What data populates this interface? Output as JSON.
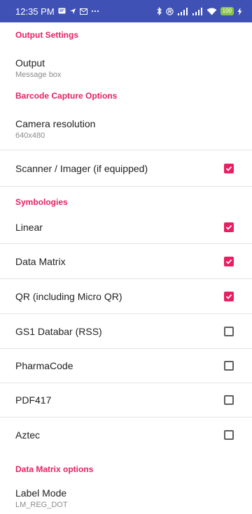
{
  "status_bar": {
    "time": "12:35 PM",
    "battery": "100"
  },
  "settings": {
    "output_settings": {
      "header": "Output Settings",
      "output": {
        "title": "Output",
        "summary": "Message box"
      }
    },
    "barcode_capture_options": {
      "header": "Barcode Capture Options",
      "camera_resolution": {
        "title": "Camera resolution",
        "summary": "640x480"
      },
      "scanner": {
        "label": "Scanner / Imager (if equipped)",
        "checked": true
      }
    },
    "symbologies": {
      "header": "Symbologies",
      "items": [
        {
          "label": "Linear",
          "checked": true
        },
        {
          "label": "Data Matrix",
          "checked": true
        },
        {
          "label": "QR (including Micro QR)",
          "checked": true
        },
        {
          "label": "GS1 Databar (RSS)",
          "checked": false
        },
        {
          "label": "PharmaCode",
          "checked": false
        },
        {
          "label": "PDF417",
          "checked": false
        },
        {
          "label": "Aztec",
          "checked": false
        }
      ]
    },
    "data_matrix_options": {
      "header": "Data Matrix options",
      "label_mode": {
        "title": "Label Mode",
        "summary": "LM_REG_DOT"
      }
    }
  },
  "colors": {
    "status_bar": "#3f51b5",
    "accent": "#e91e63",
    "divider": "#e3e3e3"
  }
}
